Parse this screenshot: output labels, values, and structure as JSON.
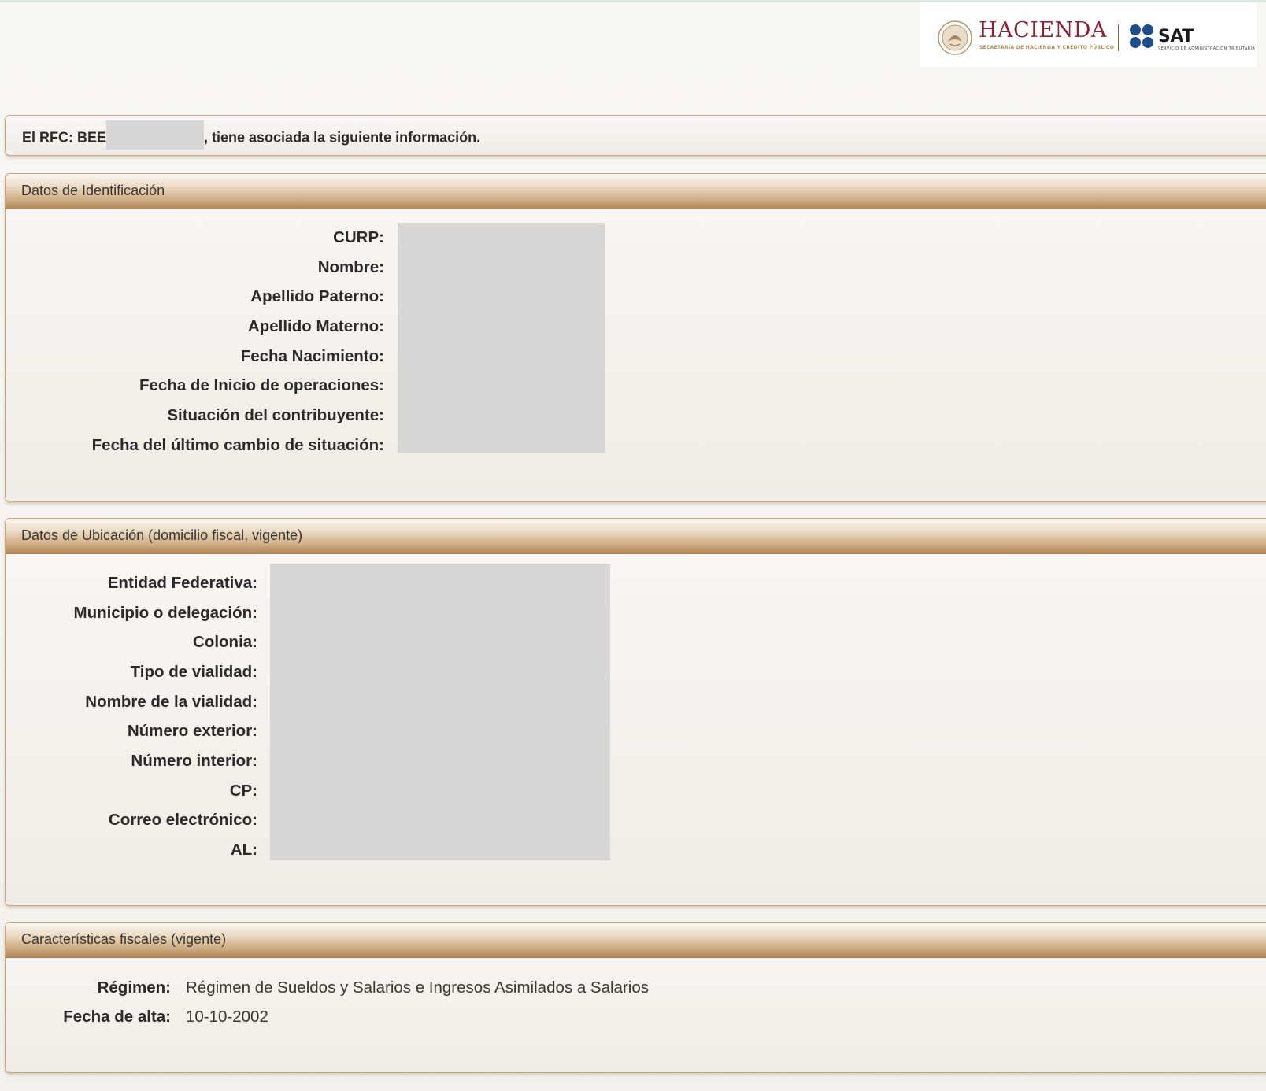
{
  "header": {
    "hacienda_title": "HACIENDA",
    "hacienda_subtitle": "SECRETARÍA DE HACIENDA Y CRÉDITO PÚBLICO",
    "sat_title": "SAT",
    "sat_subtitle": "SERVICIO DE ADMINISTRACIÓN TRIBUTARIA"
  },
  "rfc": {
    "prefix": "El RFC: BEE",
    "suffix": ", tiene asociada la siguiente información."
  },
  "identificacion": {
    "title": "Datos de Identificación",
    "labels": [
      "CURP:",
      "Nombre:",
      "Apellido Paterno:",
      "Apellido Materno:",
      "Fecha Nacimiento:",
      "Fecha de Inicio de operaciones:",
      "Situación del contribuyente:",
      "Fecha del último cambio de situación:"
    ]
  },
  "ubicacion": {
    "title": "Datos de Ubicación (domicilio fiscal, vigente)",
    "labels": [
      "Entidad Federativa:",
      "Municipio o delegación:",
      "Colonia:",
      "Tipo de vialidad:",
      "Nombre de la vialidad:",
      "Número exterior:",
      "Número interior:",
      "CP:",
      "Correo electrónico:",
      "AL:"
    ]
  },
  "fiscales": {
    "title": "Características fiscales (vigente)",
    "regimen_label": "Régimen:",
    "regimen_value": "Régimen de Sueldos y Salarios e Ingresos Asimilados a Salarios",
    "alta_label": "Fecha de alta:",
    "alta_value": "10-10-2002"
  }
}
